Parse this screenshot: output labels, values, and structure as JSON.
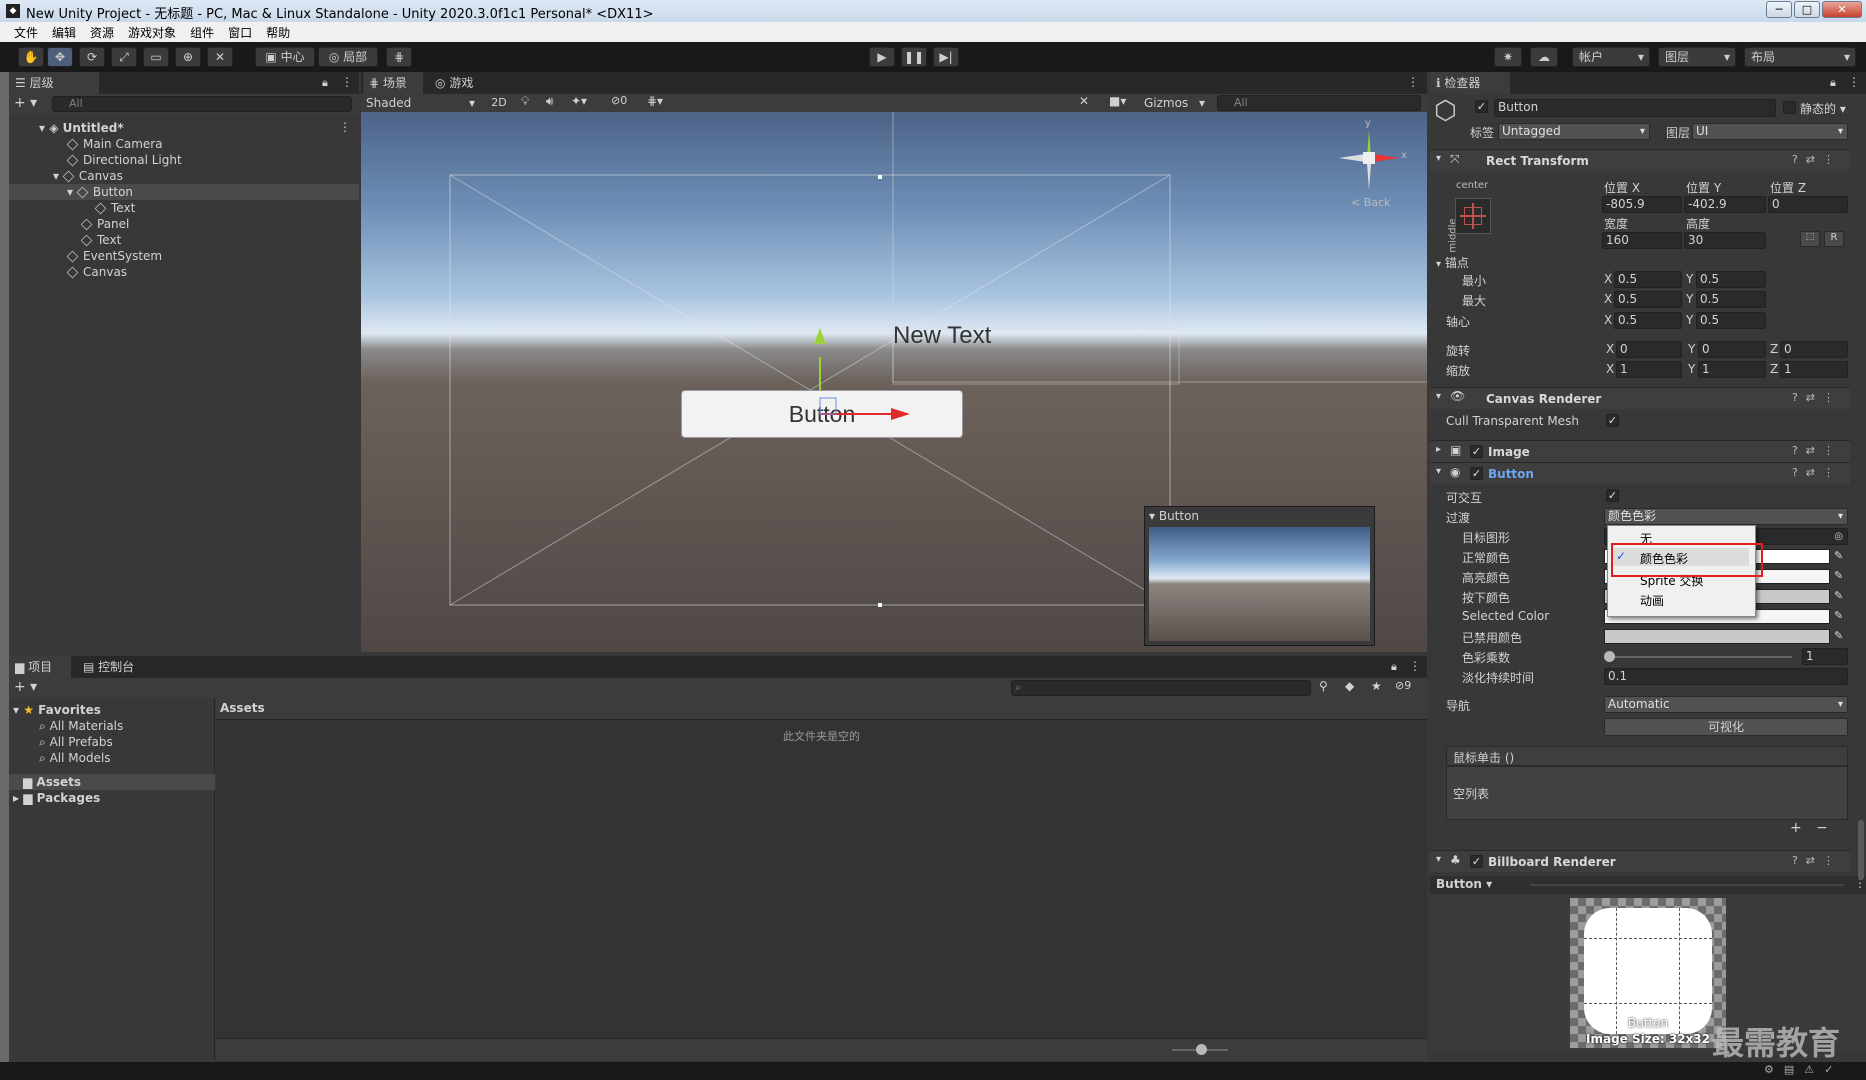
{
  "window": {
    "title": "New Unity Project - 无标题 - PC, Mac & Linux Standalone - Unity 2020.3.0f1c1 Personal* <DX11>",
    "minimize": "─",
    "maximize": "□",
    "close": "✕"
  },
  "menu": [
    "文件",
    "编辑",
    "资源",
    "游戏对象",
    "组件",
    "窗口",
    "帮助"
  ],
  "toolbar": {
    "pivot": "中心",
    "space": "局部",
    "account": "帐户",
    "layers": "图层",
    "layout": "布局"
  },
  "hierarchy": {
    "tab": "层级",
    "search_placeholder": "All",
    "scene": "Untitled*",
    "items": [
      {
        "label": "Main Camera",
        "indent": 1
      },
      {
        "label": "Directional Light",
        "indent": 1
      },
      {
        "label": "Canvas",
        "indent": 1
      },
      {
        "label": "Button",
        "indent": 2
      },
      {
        "label": "Text",
        "indent": 3
      },
      {
        "label": "Panel",
        "indent": 2
      },
      {
        "label": "Text",
        "indent": 2
      },
      {
        "label": "EventSystem",
        "indent": 1
      },
      {
        "label": "Canvas",
        "indent": 1
      }
    ]
  },
  "scene_view": {
    "tab_scene": "场景",
    "tab_game": "游戏",
    "shading": "Shaded",
    "mode_2d": "2D",
    "hidden_count": "0",
    "gizmos": "Gizmos",
    "search_placeholder": "All",
    "button_text": "Button",
    "new_text": "New Text",
    "back_label": "< Back",
    "gizmo_y": "y",
    "gizmo_x": "x",
    "preview_title": "Button"
  },
  "project": {
    "tab_project": "项目",
    "tab_console": "控制台",
    "layers_count": "9",
    "favorites": "Favorites",
    "fav_items": [
      "All Materials",
      "All Prefabs",
      "All Models"
    ],
    "assets": "Assets",
    "packages": "Packages",
    "breadcrumb": "Assets",
    "empty_message": "此文件夹是空的"
  },
  "inspector": {
    "tab": "检查器",
    "object_name": "Button",
    "static_label": "静态的",
    "tag_label": "标签",
    "tag_value": "Untagged",
    "layer_label": "图层",
    "layer_value": "UI",
    "rect_transform": {
      "title": "Rect Transform",
      "anchor_h": "center",
      "anchor_v": "middle",
      "pos_x_label": "位置 X",
      "pos_y_label": "位置 Y",
      "pos_z_label": "位置 Z",
      "pos_x": "-805.9",
      "pos_y": "-402.9",
      "pos_z": "0",
      "width_label": "宽度",
      "height_label": "高度",
      "width": "160",
      "height": "30",
      "r_label": "R",
      "anchors_label": "锚点",
      "min_label": "最小",
      "max_label": "最大",
      "pivot_label": "轴心",
      "min_x": "0.5",
      "min_y": "0.5",
      "max_x": "0.5",
      "max_y": "0.5",
      "pivot_x": "0.5",
      "pivot_y": "0.5",
      "rotation_label": "旋转",
      "scale_label": "缩放",
      "rot_x": "0",
      "rot_y": "0",
      "rot_z": "0",
      "scale_x": "1",
      "scale_y": "1",
      "scale_z": "1"
    },
    "canvas_renderer": {
      "title": "Canvas Renderer",
      "cull_label": "Cull Transparent Mesh"
    },
    "image": {
      "title": "Image"
    },
    "button": {
      "title": "Button",
      "interactable_label": "可交互",
      "transition_label": "过渡",
      "transition_value": "颜色色彩",
      "target_graphic_label": "目标图形",
      "normal_color_label": "正常颜色",
      "highlight_color_label": "高亮颜色",
      "pressed_color_label": "按下颜色",
      "selected_color_label": "Selected Color",
      "disabled_color_label": "已禁用颜色",
      "color_multiplier_label": "色彩乘数",
      "color_multiplier": "1",
      "fade_duration_label": "淡化持续时间",
      "fade_duration": "0.1",
      "navigation_label": "导航",
      "navigation_value": "Automatic",
      "visualize_label": "可视化",
      "onclick_label": "鼠标单击 ()",
      "empty_list": "空列表",
      "plus": "+",
      "minus": "−"
    },
    "transition_menu": {
      "options": [
        "无",
        "颜色色彩",
        "Sprite 交换",
        "动画"
      ],
      "selected": "颜色色彩"
    },
    "billboard": {
      "title": "Billboard Renderer"
    },
    "preview": {
      "dropdown": "Button",
      "image_label": "Button",
      "image_size": "Image Size: 32x32"
    }
  },
  "watermark": "最需教育",
  "colors": {
    "accent_blue": "#4d8ed8",
    "highlight_red": "#e02020",
    "panel_bg": "#383838",
    "tab_bg": "#282828"
  }
}
